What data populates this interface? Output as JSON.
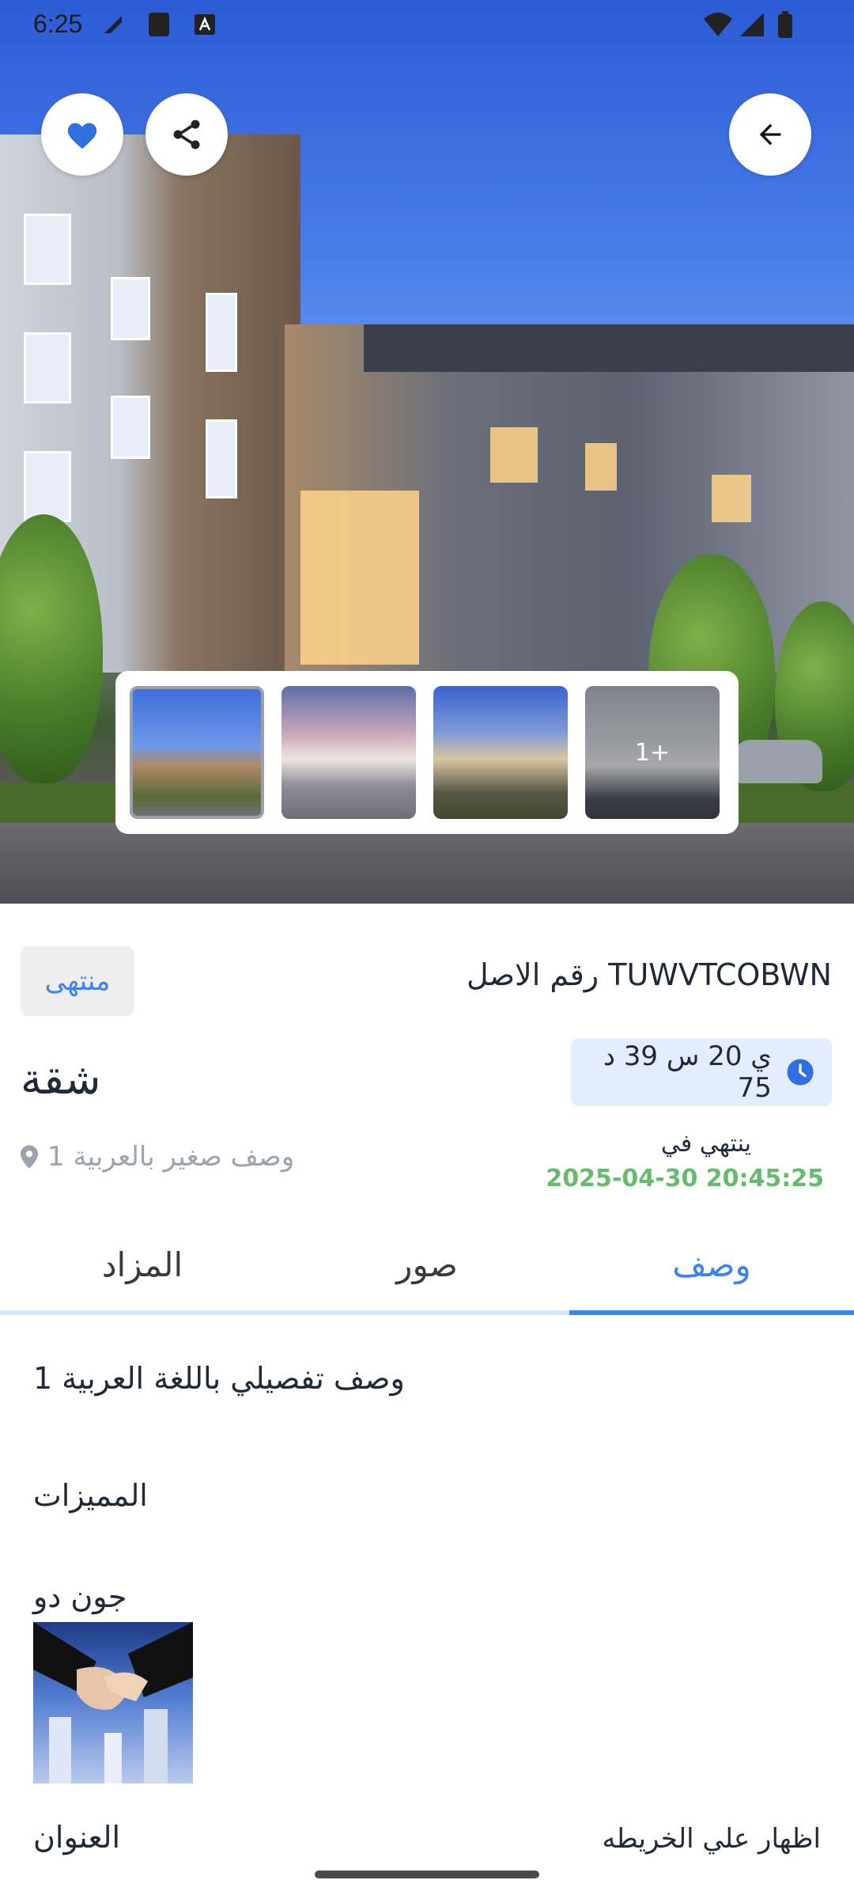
{
  "status_bar": {
    "time": "6:25"
  },
  "thumbnails": {
    "more_label": "1+"
  },
  "listing": {
    "status_chip": "منتهى",
    "asset_number": "TUWVTCOBWN رقم الاصل",
    "title": "شقة",
    "countdown": "ي 20 س 39 د 75",
    "short_description": "وصف صغير بالعربية 1",
    "ends_label": "ينتهي في",
    "ends_date": "2025-04-30 20:45:25"
  },
  "tabs": [
    {
      "label": "المزاد",
      "active": false
    },
    {
      "label": "صور",
      "active": false
    },
    {
      "label": "وصف",
      "active": true
    }
  ],
  "details": {
    "description": "وصف تفصيلي باللغة العربية 1",
    "features_heading": "المميزات",
    "owner_name": "جون دو",
    "address_heading": "العنوان",
    "map_link": "اظهار علي الخريطه"
  },
  "colors": {
    "accent": "#3b82f6",
    "date_green": "#66bb6a",
    "timer_bg": "#e3eefc"
  }
}
